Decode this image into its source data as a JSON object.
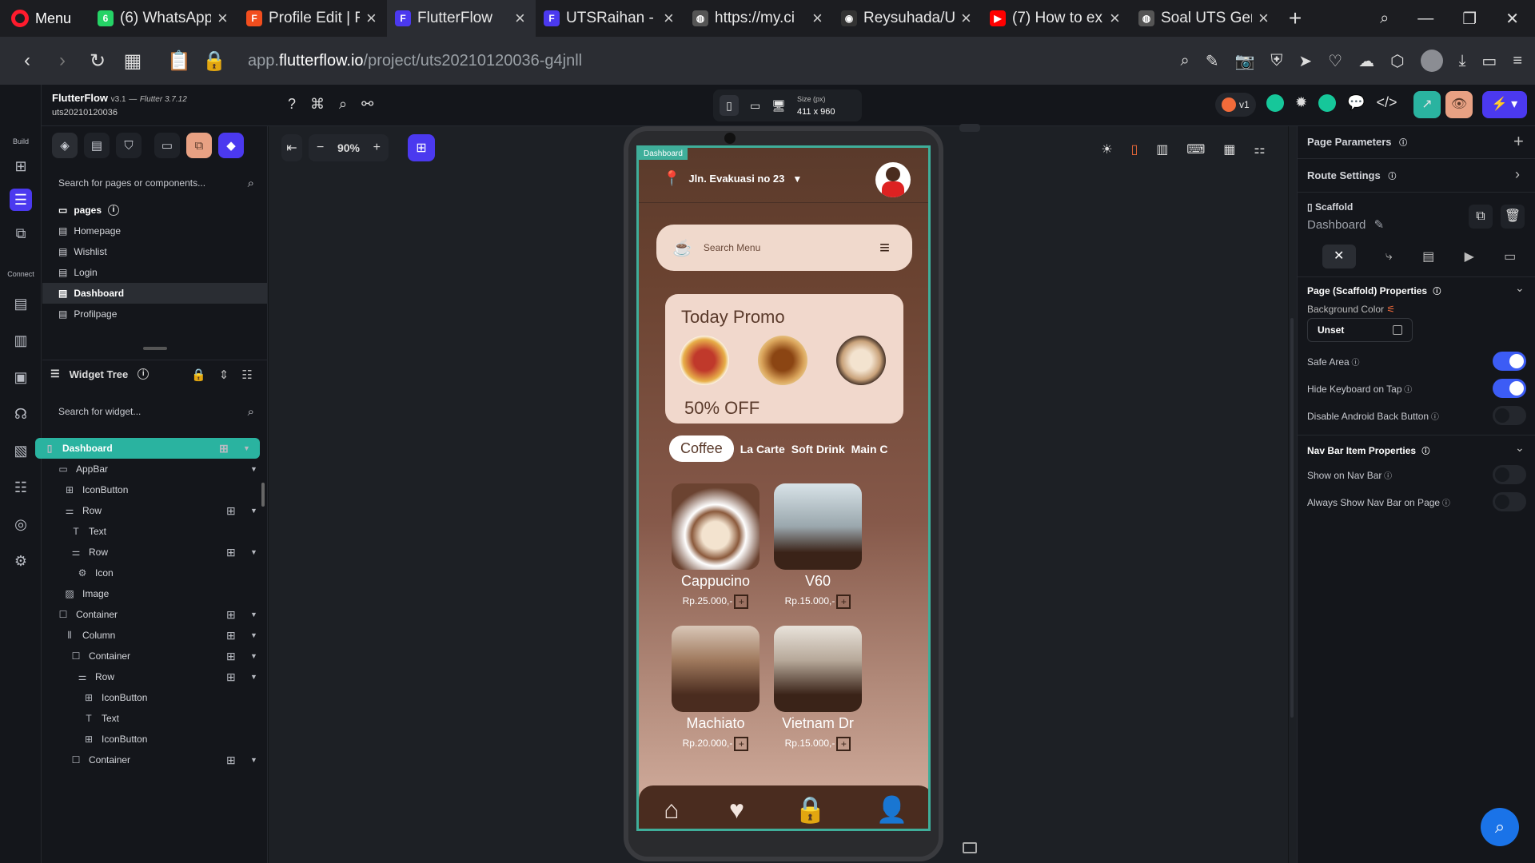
{
  "browser": {
    "menu_label": "Menu",
    "tabs": [
      {
        "title": "(6) WhatsApp",
        "icon": "whatsapp-icon",
        "badge": "6",
        "color": "#25d366"
      },
      {
        "title": "Profile Edit | F",
        "icon": "figma-icon",
        "badge": "F",
        "color": "#f24e1e"
      },
      {
        "title": "FlutterFlow",
        "icon": "flutterflow-icon",
        "badge": "F",
        "color": "#4b39ef",
        "active": true
      },
      {
        "title": "UTSRaihan -",
        "icon": "flutterflow-icon",
        "badge": "F",
        "color": "#4b39ef"
      },
      {
        "title": "https://my.ci",
        "icon": "globe-icon",
        "badge": "◍",
        "color": "#555555"
      },
      {
        "title": "Reysuhada/U",
        "icon": "github-icon",
        "badge": "◉",
        "color": "#333333"
      },
      {
        "title": "(7) How to ex",
        "icon": "youtube-icon",
        "badge": "▶",
        "color": "#ff0000"
      },
      {
        "title": "Soal UTS Ger",
        "icon": "globe-icon",
        "badge": "◍",
        "color": "#555555"
      }
    ],
    "url_prefix": "app.",
    "url_domain": "flutterflow.io",
    "url_path": "/project/uts20210120036-g4jnll"
  },
  "project": {
    "app_name": "FlutterFlow",
    "version": "v3.1",
    "flutter_version": "Flutter 3.7.12",
    "project_id": "uts20210120036"
  },
  "rail": {
    "build_label": "Build",
    "connect_label": "Connect"
  },
  "toolbar": {
    "zoom": "90%",
    "size_label": "Size (px)",
    "size_value": "411 x 960",
    "version_label": "v1"
  },
  "pages_panel": {
    "search_placeholder": "Search for pages or components...",
    "header": "pages",
    "pages": [
      "Homepage",
      "Wishlist",
      "Login",
      "Dashboard",
      "Profilpage"
    ],
    "selected": "Dashboard"
  },
  "widget_tree": {
    "title": "Widget Tree",
    "search_placeholder": "Search for widget...",
    "items": [
      {
        "label": "Dashboard",
        "icon": "phone-icon",
        "depth": 0,
        "add": true,
        "caret": true,
        "selected": true
      },
      {
        "label": "AppBar",
        "icon": "appbar-icon",
        "depth": 1,
        "add": false,
        "caret": true
      },
      {
        "label": "IconButton",
        "icon": "iconbutton-icon",
        "depth": 2,
        "add": false,
        "caret": false
      },
      {
        "label": "Row",
        "icon": "row-icon",
        "depth": 2,
        "add": true,
        "caret": true
      },
      {
        "label": "Text",
        "icon": "text-icon",
        "depth": 3,
        "add": false,
        "caret": false
      },
      {
        "label": "Row",
        "icon": "row-icon",
        "depth": 3,
        "add": true,
        "caret": true
      },
      {
        "label": "Icon",
        "icon": "gear-icon",
        "depth": 4,
        "add": false,
        "caret": false
      },
      {
        "label": "Image",
        "icon": "image-icon",
        "depth": 2,
        "add": false,
        "caret": false
      },
      {
        "label": "Container",
        "icon": "container-icon",
        "depth": 1,
        "add": true,
        "caret": true
      },
      {
        "label": "Column",
        "icon": "column-icon",
        "depth": 2,
        "add": true,
        "caret": true
      },
      {
        "label": "Container",
        "icon": "container-icon",
        "depth": 3,
        "add": true,
        "caret": true
      },
      {
        "label": "Row",
        "icon": "row-icon",
        "depth": 4,
        "add": true,
        "caret": true
      },
      {
        "label": "IconButton",
        "icon": "iconbutton-icon",
        "depth": 5,
        "add": false,
        "caret": false
      },
      {
        "label": "Text",
        "icon": "text-icon",
        "depth": 5,
        "add": false,
        "caret": false
      },
      {
        "label": "IconButton",
        "icon": "iconbutton-icon",
        "depth": 5,
        "add": false,
        "caret": false
      },
      {
        "label": "Container",
        "icon": "container-icon",
        "depth": 3,
        "add": true,
        "caret": true
      }
    ]
  },
  "app": {
    "page_label": "Dashboard",
    "location": "Jln. Evakuasi no 23",
    "search_placeholder": "Search Menu",
    "promo_title": "Today Promo",
    "promo_discount": "50% OFF",
    "categories": [
      "Coffee",
      "La Carte",
      "Soft Drink",
      "Main C"
    ],
    "products": [
      {
        "name": "Cappucino",
        "price": "Rp.25.000,-"
      },
      {
        "name": "V60",
        "price": "Rp.15.000,-"
      },
      {
        "name": "Machiato",
        "price": "Rp.20.000,-"
      },
      {
        "name": "Vietnam Dr",
        "price": "Rp.15.000,-"
      }
    ],
    "nav": [
      "home-icon",
      "heart-icon",
      "bag-icon",
      "person-icon"
    ]
  },
  "right_panel": {
    "page_parameters": "Page Parameters",
    "route_settings": "Route Settings",
    "scaffold_label": "Scaffold",
    "scaffold_name": "Dashboard",
    "props_header": "Page (Scaffold) Properties",
    "bg_color_label": "Background Color",
    "bg_color_value": "Unset",
    "toggles": [
      {
        "label": "Safe Area",
        "on": true
      },
      {
        "label": "Hide Keyboard on Tap",
        "on": true
      },
      {
        "label": "Disable Android Back Button",
        "on": false
      }
    ],
    "navbar_header": "Nav Bar Item Properties",
    "navbar_toggles": [
      {
        "label": "Show on Nav Bar",
        "on": false
      },
      {
        "label": "Always Show Nav Bar on Page",
        "on": false
      }
    ]
  }
}
